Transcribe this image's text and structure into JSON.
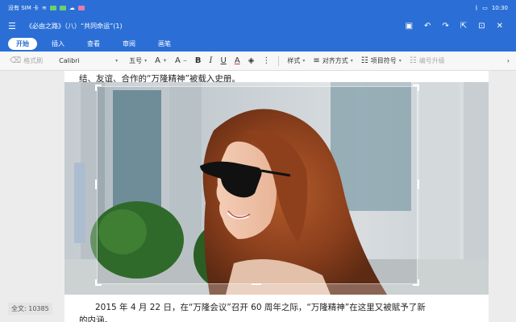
{
  "status": {
    "carrier": "没有 SIM 卡",
    "time": "10:30"
  },
  "titlebar": {
    "title": "《必由之路》（八）“共同命运”(1)"
  },
  "tabs": [
    {
      "label": "开始",
      "active": true
    },
    {
      "label": "插入",
      "active": false
    },
    {
      "label": "查看",
      "active": false
    },
    {
      "label": "审阅",
      "active": false
    },
    {
      "label": "画笔",
      "active": false
    }
  ],
  "toolbar": {
    "format_brush": "格式刷",
    "font": "Calibri",
    "size": "五号",
    "style": "样式",
    "align": "对齐方式",
    "bullets": "项目符号",
    "numbering": "编号升级"
  },
  "doc": {
    "line_top": "结、友谊、合作的“万隆精神”被载入史册。",
    "line_bottom": "2015 年 4 月 22 日，在“万隆会议”召开 60 周年之际，“万隆精神”在这里又被赋予了新",
    "line_last": "的内涵。"
  },
  "wordcount": "全文: 10385",
  "colors": {
    "accent": "#2b6fd6"
  }
}
